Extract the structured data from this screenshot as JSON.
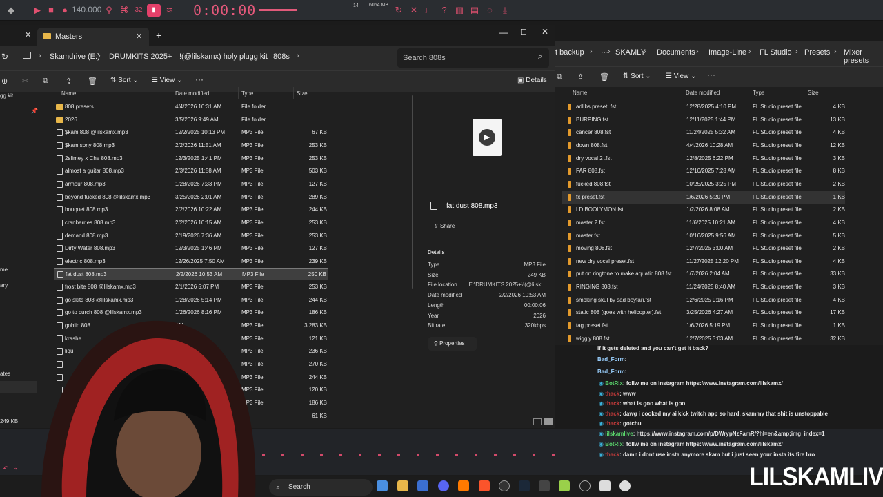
{
  "fl": {
    "tempo": "140.000",
    "time": "0:00:00",
    "cpu": "6064 MB",
    "voices": "14",
    "pattern_label": "32"
  },
  "explorer": {
    "tab_title": "Masters",
    "breadcrumb": [
      "Skamdrive (E:)",
      "DRUMKITS 2025+",
      "!(@lilskamx) holy plugg kit",
      "808s"
    ],
    "search_placeholder": "Search 808s",
    "commands": {
      "sort": "Sort",
      "view": "View",
      "more": "···",
      "details": "Details"
    },
    "nav_items": [
      "gg kit",
      "me",
      "ary",
      "ates"
    ],
    "status": "249 KB",
    "columns": [
      "Name",
      "Date modified",
      "Type",
      "Size"
    ],
    "rows": [
      {
        "name": "808 presets",
        "date": "4/4/2026 10:31 AM",
        "type": "File folder",
        "size": "",
        "folder": true
      },
      {
        "name": "2026",
        "date": "3/5/2026 9:49 AM",
        "type": "File folder",
        "size": "",
        "folder": true
      },
      {
        "name": "$kam 808 @lilskamx.mp3",
        "date": "12/2/2025 10:13 PM",
        "type": "MP3 File",
        "size": "67 KB"
      },
      {
        "name": "$kam sony 808.mp3",
        "date": "2/2/2026 11:51 AM",
        "type": "MP3 File",
        "size": "253 KB"
      },
      {
        "name": "2slimey x Che 808.mp3",
        "date": "12/3/2025 1:41 PM",
        "type": "MP3 File",
        "size": "253 KB"
      },
      {
        "name": "almost a guitar 808.mp3",
        "date": "2/3/2026 11:58 AM",
        "type": "MP3 File",
        "size": "503 KB"
      },
      {
        "name": "armour 808.mp3",
        "date": "1/28/2026 7:33 PM",
        "type": "MP3 File",
        "size": "127 KB"
      },
      {
        "name": "beyond fucked 808 @lilskamx.mp3",
        "date": "3/25/2026 2:01 AM",
        "type": "MP3 File",
        "size": "289 KB"
      },
      {
        "name": "bouquet 808.mp3",
        "date": "2/2/2026 10:22 AM",
        "type": "MP3 File",
        "size": "244 KB"
      },
      {
        "name": "cranberries 808.mp3",
        "date": "2/2/2026 10:15 AM",
        "type": "MP3 File",
        "size": "253 KB"
      },
      {
        "name": "demand 808.mp3",
        "date": "2/19/2026 7:36 AM",
        "type": "MP3 File",
        "size": "253 KB"
      },
      {
        "name": "Dirty Water 808.mp3",
        "date": "12/3/2025 1:46 PM",
        "type": "MP3 File",
        "size": "127 KB"
      },
      {
        "name": "electric 808.mp3",
        "date": "12/26/2025 7:50 AM",
        "type": "MP3 File",
        "size": "239 KB"
      },
      {
        "name": "fat dust 808.mp3",
        "date": "2/2/2026 10:53 AM",
        "type": "MP3 File",
        "size": "250 KB",
        "selected": true
      },
      {
        "name": "frost bite 808 @lilskamx.mp3",
        "date": "2/1/2026 5:07 PM",
        "type": "MP3 File",
        "size": "253 KB"
      },
      {
        "name": "go skits 808 @lilskamx.mp3",
        "date": "1/28/2026 5:14 PM",
        "type": "MP3 File",
        "size": "244 KB"
      },
      {
        "name": "go to curch 808 @lilskamx.mp3",
        "date": "1/26/2026 8:16 PM",
        "type": "MP3 File",
        "size": "186 KB"
      },
      {
        "name": "goblin 808",
        "date": "PM",
        "type": "MP3 File",
        "size": "3,283 KB"
      },
      {
        "name": "krashe",
        "date": "AM",
        "type": "MP3 File",
        "size": "121 KB"
      },
      {
        "name": "liqu",
        "date": "",
        "type": "MP3 File",
        "size": "236 KB"
      },
      {
        "name": "",
        "date": "",
        "type": "MP3 File",
        "size": "270 KB"
      },
      {
        "name": "",
        "date": "",
        "type": "MP3 File",
        "size": "244 KB"
      },
      {
        "name": "",
        "date": "",
        "type": "MP3 File",
        "size": "120 KB"
      },
      {
        "name": "",
        "date": "",
        "type": "MP3 File",
        "size": "186 KB"
      },
      {
        "name": "",
        "date": "",
        "type": "",
        "size": "61 KB"
      }
    ],
    "preview": {
      "filename": "fat dust 808.mp3",
      "share": "Share",
      "details_header": "Details",
      "properties": "Properties",
      "fields": [
        {
          "label": "Type",
          "value": "MP3 File"
        },
        {
          "label": "Size",
          "value": "249 KB"
        },
        {
          "label": "File location",
          "value": "E:\\DRUMKITS 2025+\\!(@lilsk..."
        },
        {
          "label": "Date modified",
          "value": "2/2/2026 10:53 AM"
        },
        {
          "label": "Length",
          "value": "00:00:06"
        },
        {
          "label": "Year",
          "value": "2026"
        },
        {
          "label": "Bit rate",
          "value": "320kbps"
        }
      ]
    }
  },
  "explorer2": {
    "breadcrumb": [
      "t backup",
      "···",
      "SKAMLY",
      "Documents",
      "Image-Line",
      "FL Studio",
      "Presets",
      "Mixer presets"
    ],
    "commands": {
      "sort": "Sort",
      "view": "View",
      "more": "···"
    },
    "columns": [
      "Name",
      "Date modified",
      "Type",
      "Size"
    ],
    "rows": [
      {
        "name": "adlibs preset .fst",
        "date": "12/28/2025 4:10 PM",
        "type": "FL Studio preset file",
        "size": "4 KB"
      },
      {
        "name": "BURPING.fst",
        "date": "12/11/2025 1:44 PM",
        "type": "FL Studio preset file",
        "size": "13 KB"
      },
      {
        "name": "cancer 808.fst",
        "date": "11/24/2025 5:32 AM",
        "type": "FL Studio preset file",
        "size": "4 KB"
      },
      {
        "name": "down 808.fst",
        "date": "4/4/2026 10:28 AM",
        "type": "FL Studio preset file",
        "size": "12 KB"
      },
      {
        "name": "dry vocal 2 .fst",
        "date": "12/8/2025 6:22 PM",
        "type": "FL Studio preset file",
        "size": "3 KB"
      },
      {
        "name": "FAR 808.fst",
        "date": "12/10/2025 7:28 AM",
        "type": "FL Studio preset file",
        "size": "8 KB"
      },
      {
        "name": "fucked 808.fst",
        "date": "10/25/2025 3:25 PM",
        "type": "FL Studio preset file",
        "size": "2 KB"
      },
      {
        "name": "fx preset.fst",
        "date": "1/6/2026 5:20 PM",
        "type": "FL Studio preset file",
        "size": "1 KB",
        "hl": true
      },
      {
        "name": "LD BOOLYMON.fst",
        "date": "1/2/2026 8:08 AM",
        "type": "FL Studio preset file",
        "size": "2 KB"
      },
      {
        "name": "master 2.fst",
        "date": "11/6/2025 10:21 AM",
        "type": "FL Studio preset file",
        "size": "4 KB"
      },
      {
        "name": "master.fst",
        "date": "10/16/2025 9:56 AM",
        "type": "FL Studio preset file",
        "size": "5 KB"
      },
      {
        "name": "moving 808.fst",
        "date": "12/7/2025 3:00 AM",
        "type": "FL Studio preset file",
        "size": "2 KB"
      },
      {
        "name": "new dry vocal preset.fst",
        "date": "11/27/2025 12:20 PM",
        "type": "FL Studio preset file",
        "size": "4 KB"
      },
      {
        "name": "put on ringtone to make aquatic 808.fst",
        "date": "1/7/2026 2:04 AM",
        "type": "FL Studio preset file",
        "size": "33 KB"
      },
      {
        "name": "RINGING 808.fst",
        "date": "11/24/2025 8:40 AM",
        "type": "FL Studio preset file",
        "size": "3 KB"
      },
      {
        "name": "smoking skul by sad boyfari.fst",
        "date": "12/6/2025 9:16 PM",
        "type": "FL Studio preset file",
        "size": "4 KB"
      },
      {
        "name": "static 808 (goes with helicopter).fst",
        "date": "3/25/2026 4:27 AM",
        "type": "FL Studio preset file",
        "size": "17 KB"
      },
      {
        "name": "tag preset.fst",
        "date": "1/6/2026 5:19 PM",
        "type": "FL Studio preset file",
        "size": "1 KB"
      },
      {
        "name": "wiggly 808.fst",
        "date": "12/7/2025 3:03 AM",
        "type": "FL Studio preset file",
        "size": "32 KB"
      }
    ]
  },
  "chat": [
    {
      "user": "",
      "text": "if it gets deleted and you can't get it back?",
      "ucolor": "#ffffff"
    },
    {
      "user": "Bad_Form",
      "text": ":",
      "ucolor": "#9ad0ff"
    },
    {
      "user": "Bad_Form",
      "text": ":",
      "ucolor": "#9ad0ff"
    },
    {
      "user": "BotRix",
      "text": ": follw me on instagram https://www.instagram.com/lilskamx/",
      "ucolor": "#59d36b"
    },
    {
      "user": "thack",
      "text": ": www",
      "ucolor": "#c43b3b"
    },
    {
      "user": "thack",
      "text": ": what is goo what is goo",
      "ucolor": "#c43b3b"
    },
    {
      "user": "thack",
      "text": ": dawg i cooked my ai kick twitch app so hard. skammy that shit is unstoppable",
      "ucolor": "#c43b3b"
    },
    {
      "user": "thack",
      "text": ": gotchu",
      "ucolor": "#c43b3b"
    },
    {
      "user": "lilskamlive",
      "text": ": https://www.instagram.com/p/DWrypNzFamR/?hl=en&amp;img_index=1",
      "ucolor": "#59d36b"
    },
    {
      "user": "BotRix",
      "text": ": follw me on instagram https://www.instagram.com/lilskamx/",
      "ucolor": "#59d36b"
    },
    {
      "user": "thack",
      "text": ": damn i dont use insta anymore skam but i just seen your insta its fire bro",
      "ucolor": "#c43b3b"
    }
  ],
  "taskbar": {
    "search": "Search"
  },
  "watermark": "LILSKAMLIVE"
}
